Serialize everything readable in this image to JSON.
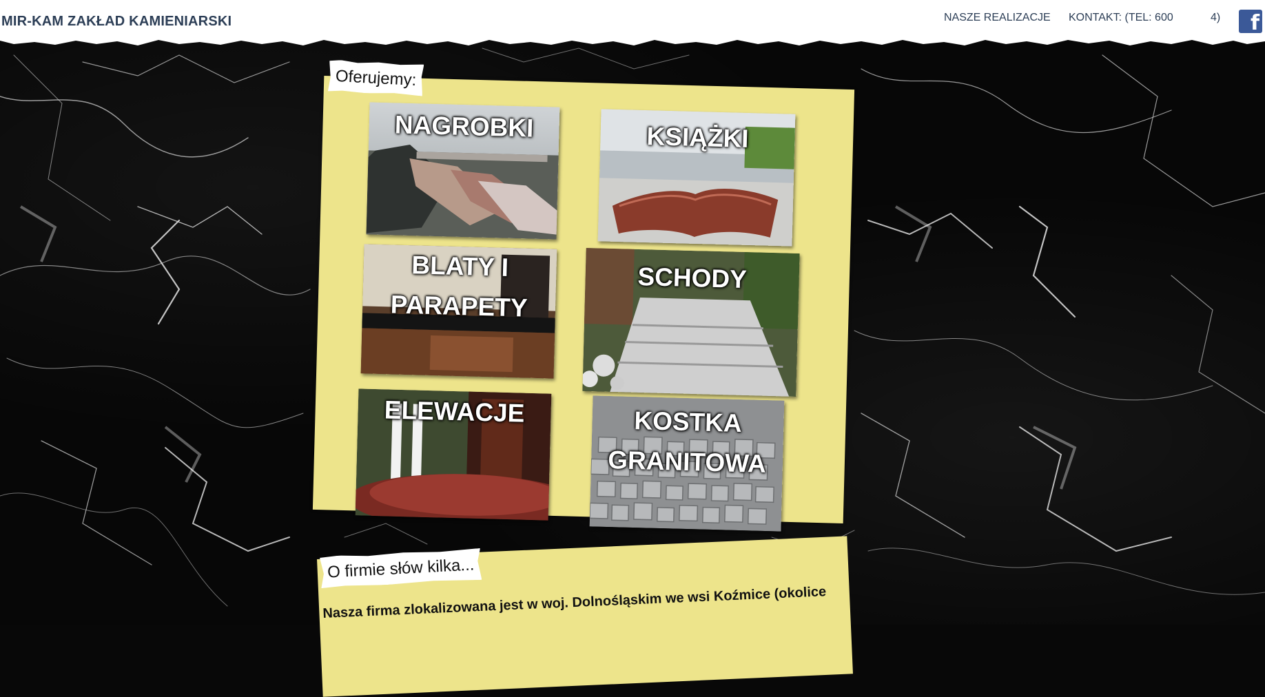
{
  "header": {
    "logo": "MIR-KAM ZAKŁAD KAMIENIARSKI",
    "nav": [
      {
        "label": "NASZE REALIZACJE"
      },
      {
        "label": "KONTAKT: (TEL: 600"
      },
      {
        "label": "4)"
      }
    ],
    "facebook_icon": "facebook-icon",
    "facebook_color": "#3b5998"
  },
  "offer": {
    "label": "Oferujemy:",
    "tiles": [
      {
        "title": "NAGROBKI"
      },
      {
        "title": "KSIĄŻKI"
      },
      {
        "title": "BLATY I PARAPETY"
      },
      {
        "title": "SCHODY"
      },
      {
        "title": "ELEWACJE"
      },
      {
        "title": "KOSTKA GRANITOWA"
      }
    ]
  },
  "about": {
    "label": "O firmie słów kilka...",
    "text": "Nasza firma zlokalizowana jest w woj. Dolnośląskim we wsi Koźmice (okolice"
  },
  "colors": {
    "panel": "#ede48b",
    "header_text": "#2c3e56",
    "background": "#070707"
  }
}
